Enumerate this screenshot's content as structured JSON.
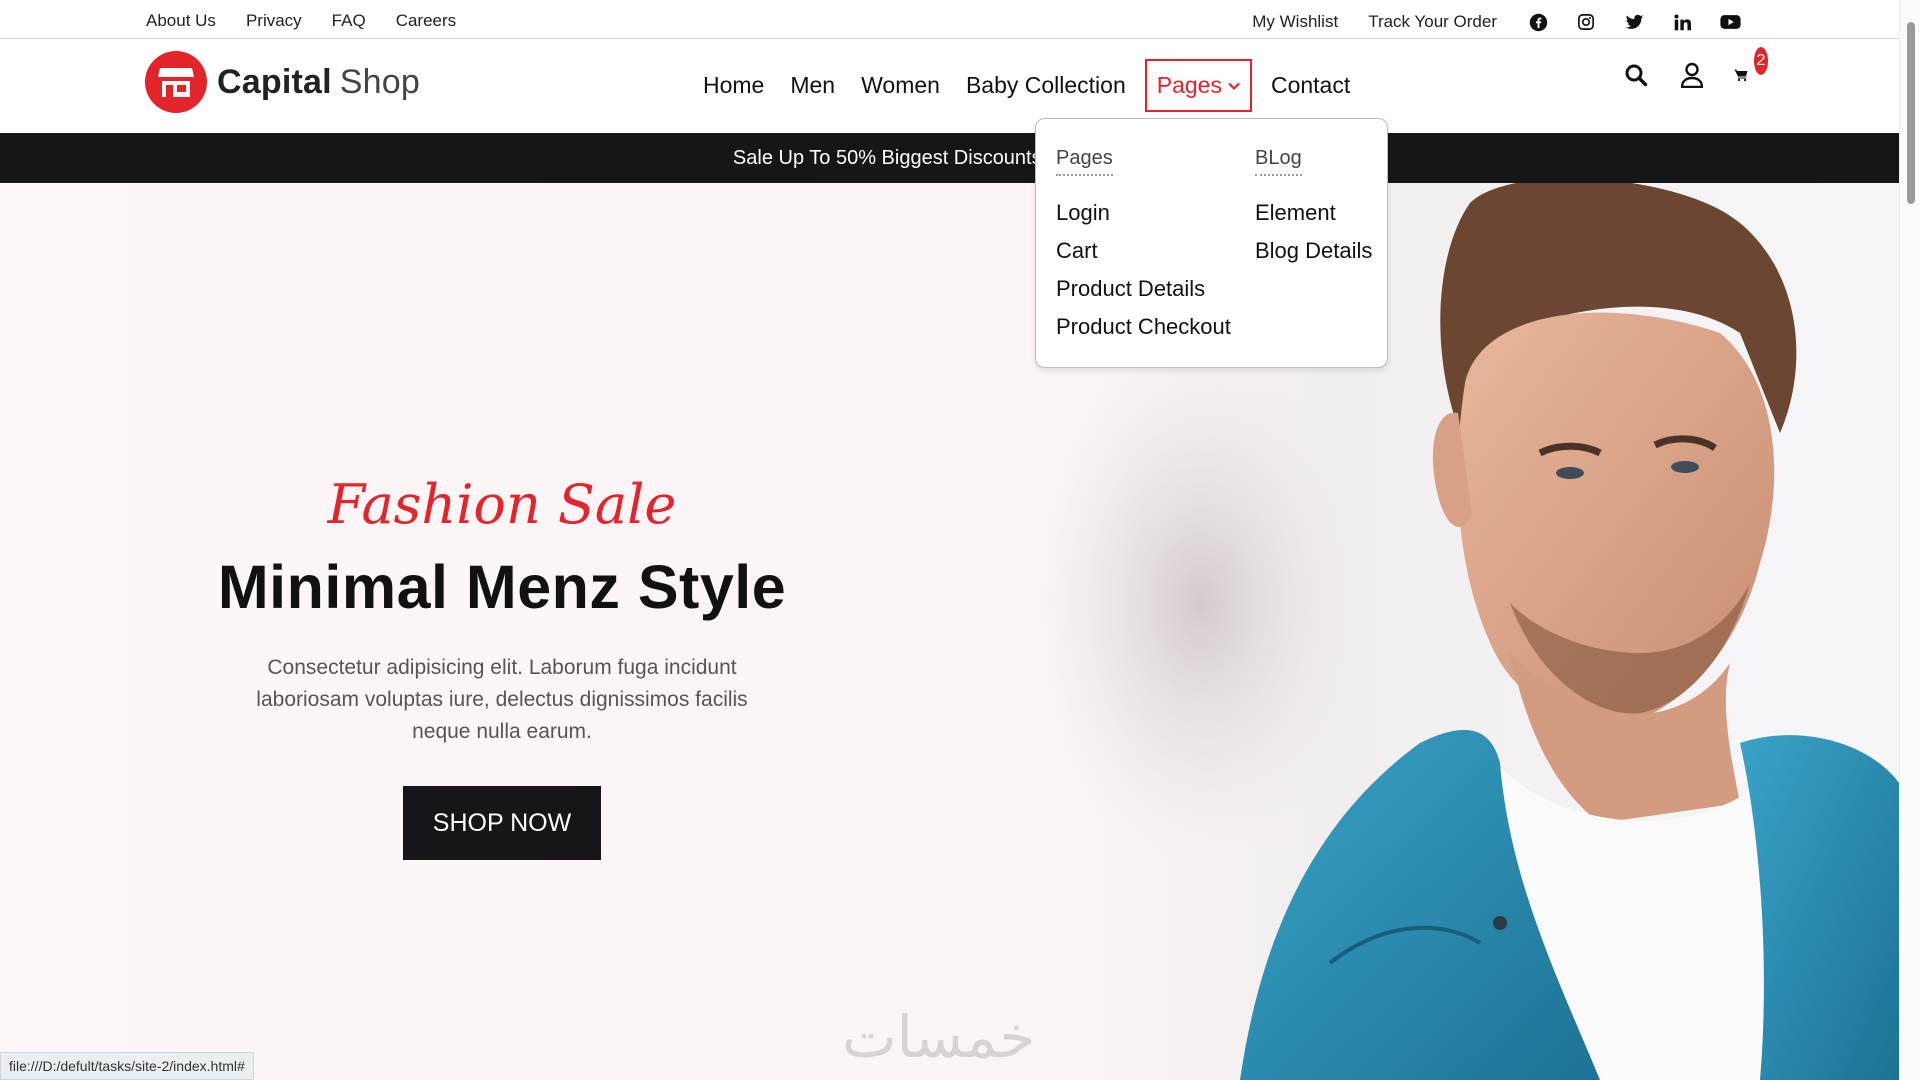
{
  "topbar": {
    "left_links": [
      "About Us",
      "Privacy",
      "FAQ",
      "Careers"
    ],
    "right_links": [
      "My Wishlist",
      "Track Your Order"
    ],
    "social_icons": [
      "facebook-icon",
      "instagram-icon",
      "twitter-icon",
      "linkedin-icon",
      "youtube-icon"
    ]
  },
  "brand": {
    "bold": "Capital",
    "light": "Shop",
    "accent": "#e3242b"
  },
  "nav": {
    "items": [
      "Home",
      "Men",
      "Women",
      "Baby Collection",
      "Pages",
      "Contact"
    ],
    "active": "Pages"
  },
  "header_icons": {
    "search": "search-icon",
    "user": "user-icon",
    "cart": "cart-icon",
    "cart_count": "2"
  },
  "promo": {
    "text": "Sale Up To 50% Biggest Discounts. Hurry! Limite"
  },
  "dropdown": {
    "col1": {
      "heading": "Pages",
      "links": [
        "Login",
        "Cart",
        "Product Details",
        "Product Checkout"
      ]
    },
    "col2": {
      "heading": "BLog",
      "links": [
        "Element",
        "Blog Details"
      ]
    }
  },
  "hero": {
    "script_title": "Fashion Sale",
    "headline": "Minimal Menz Style",
    "description": "Consectetur adipisicing elit. Laborum fuga incidunt laboriosam voluptas iure, delectus dignissimos facilis neque nulla earum.",
    "button": "SHOP NOW"
  },
  "watermark": "خمسات",
  "status_bar": "file:///D:/defult/tasks/site-2/index.html#"
}
